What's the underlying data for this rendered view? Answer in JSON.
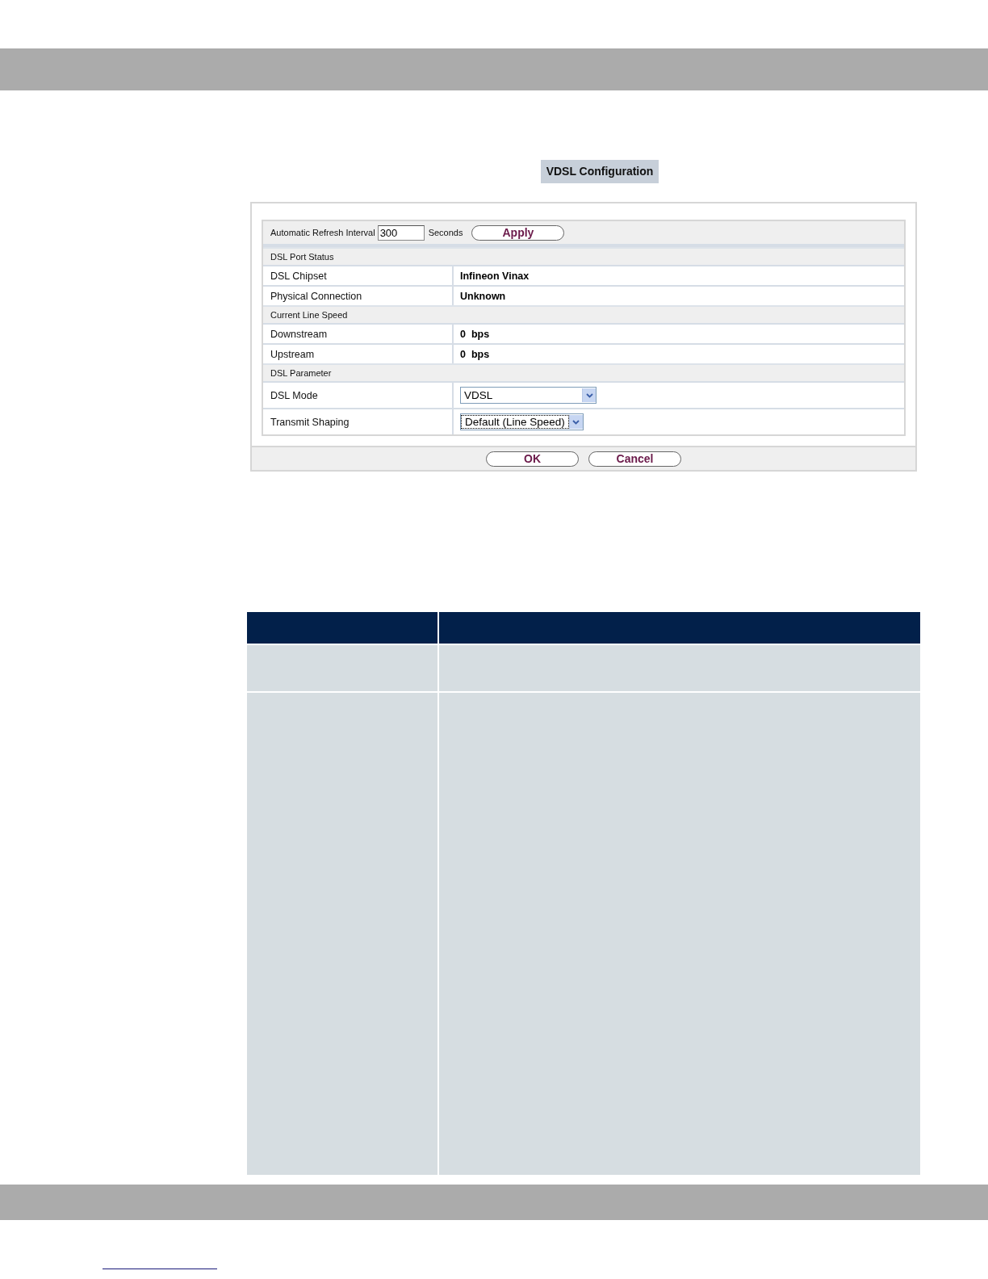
{
  "page_title": "VDSL Configuration",
  "refresh": {
    "label": "Automatic Refresh Interval",
    "value": "300",
    "unit": "Seconds",
    "button": "Apply"
  },
  "sections": [
    {
      "title": "DSL Port Status",
      "rows": [
        {
          "label": "DSL Chipset",
          "kind": "text",
          "value": "Infineon Vinax"
        },
        {
          "label": "Physical Connection",
          "kind": "text",
          "value": "Unknown"
        }
      ]
    },
    {
      "title": "Current Line Speed",
      "rows": [
        {
          "label": "Downstream",
          "kind": "text",
          "value": "0  bps"
        },
        {
          "label": "Upstream",
          "kind": "text",
          "value": "0  bps"
        }
      ]
    },
    {
      "title": "DSL Parameter",
      "rows": [
        {
          "label": "DSL Mode",
          "kind": "select",
          "value": "VDSL",
          "focused": false
        },
        {
          "label": "Transmit Shaping",
          "kind": "select",
          "value": "Default (Line Speed)",
          "focused": true
        }
      ]
    }
  ],
  "buttons": [
    "OK",
    "Cancel"
  ]
}
